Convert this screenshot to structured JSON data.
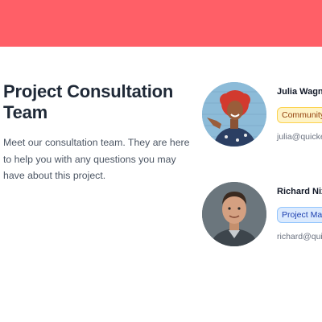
{
  "header": {
    "banner_color": "#ff5f67"
  },
  "intro": {
    "title": "Project Consultation Team",
    "description": "Meet our consultation team. They are here to help you with any questions you may have about this project."
  },
  "team": [
    {
      "name": "Julia Wagne",
      "role": "Community",
      "email": "julia@quicke",
      "avatar_icon": "person-photo-avatar"
    },
    {
      "name": "Richard Nix",
      "role": "Project Mar",
      "email": "richard@quic",
      "avatar_icon": "person-photo-avatar"
    }
  ]
}
